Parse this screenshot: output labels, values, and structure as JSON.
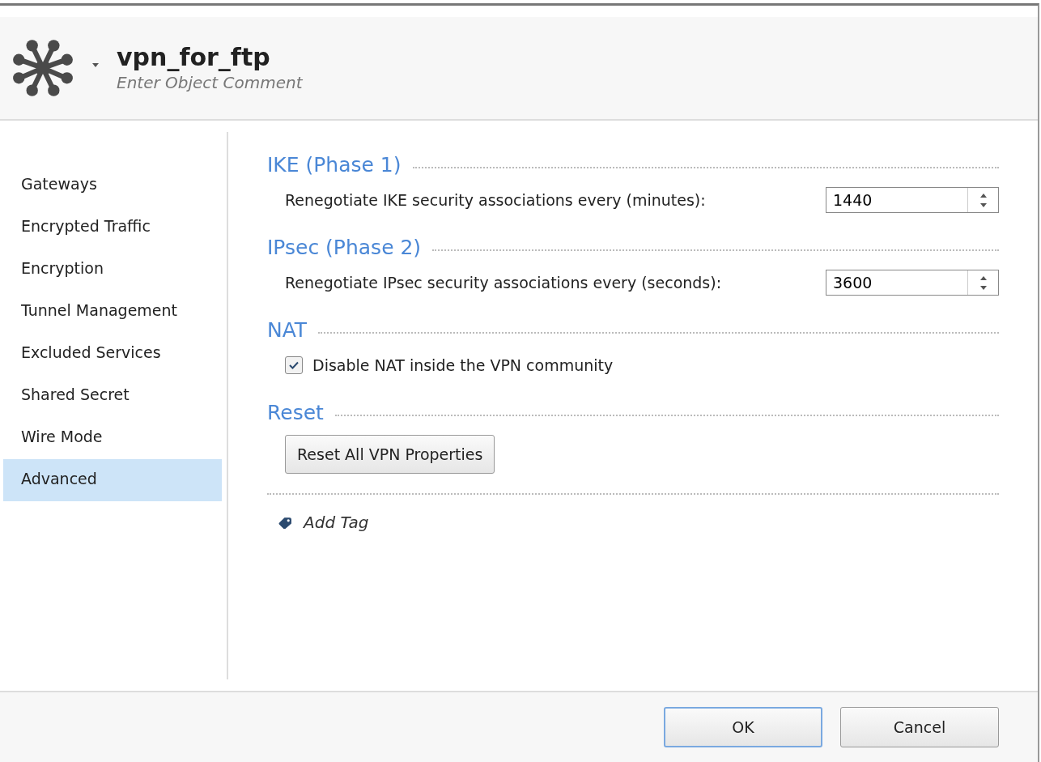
{
  "header": {
    "title": "vpn_for_ftp",
    "comment_placeholder": "Enter Object Comment"
  },
  "sidebar": {
    "items": [
      {
        "label": "Gateways",
        "selected": false
      },
      {
        "label": "Encrypted Traffic",
        "selected": false
      },
      {
        "label": "Encryption",
        "selected": false
      },
      {
        "label": "Tunnel Management",
        "selected": false
      },
      {
        "label": "Excluded Services",
        "selected": false
      },
      {
        "label": "Shared Secret",
        "selected": false
      },
      {
        "label": "Wire Mode",
        "selected": false
      },
      {
        "label": "Advanced",
        "selected": true
      }
    ]
  },
  "sections": [
    {
      "title": "IKE (Phase 1)",
      "kind": "spinner",
      "label": "Renegotiate IKE security associations every (minutes):",
      "value": "1440"
    },
    {
      "title": "IPsec (Phase 2)",
      "kind": "spinner",
      "label": "Renegotiate IPsec security associations every (seconds):",
      "value": "3600"
    },
    {
      "title": "NAT",
      "kind": "checkbox",
      "label": "Disable NAT inside the VPN community",
      "checked": true
    },
    {
      "title": "Reset",
      "kind": "button",
      "label": "Reset All VPN Properties"
    }
  ],
  "add_tag": "Add Tag",
  "buttons": [
    {
      "label": "OK",
      "default": true
    },
    {
      "label": "Cancel",
      "default": false
    }
  ]
}
